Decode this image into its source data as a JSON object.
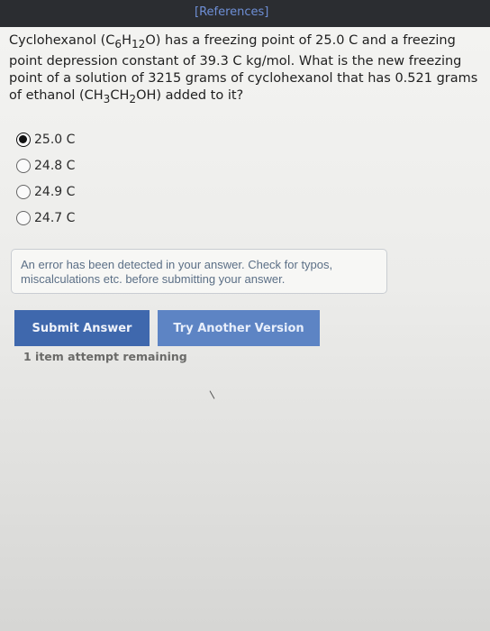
{
  "header": {
    "references_label": "[References]"
  },
  "question": {
    "parts": [
      "Cyclohexanol (C",
      "6",
      "H",
      "12",
      "O) has a freezing point of 25.0 C  and a freezing point depression constant of 39.3 C kg/mol.  What is the new freezing point of a solution of 3215 grams of cyclohexanol that has 0.521 grams of ethanol (CH",
      "3",
      "CH",
      "2",
      "OH) added to it?"
    ]
  },
  "options": [
    {
      "label": "25.0 C",
      "selected": true
    },
    {
      "label": "24.8 C",
      "selected": false
    },
    {
      "label": "24.9 C",
      "selected": false
    },
    {
      "label": "24.7 C",
      "selected": false
    }
  ],
  "error": {
    "message": "An error has been detected in your answer. Check for typos, miscalculations etc. before submitting your answer."
  },
  "buttons": {
    "submit_label": "Submit Answer",
    "try_another_label": "Try Another Version"
  },
  "attempts": {
    "text": "1 item attempt remaining"
  },
  "colors": {
    "top_bar": "#2b2d31",
    "references_link": "#6e8fd6",
    "submit_button": "#3f68ad",
    "try_another_button": "#5d84c4",
    "error_text": "#5b6f86"
  }
}
